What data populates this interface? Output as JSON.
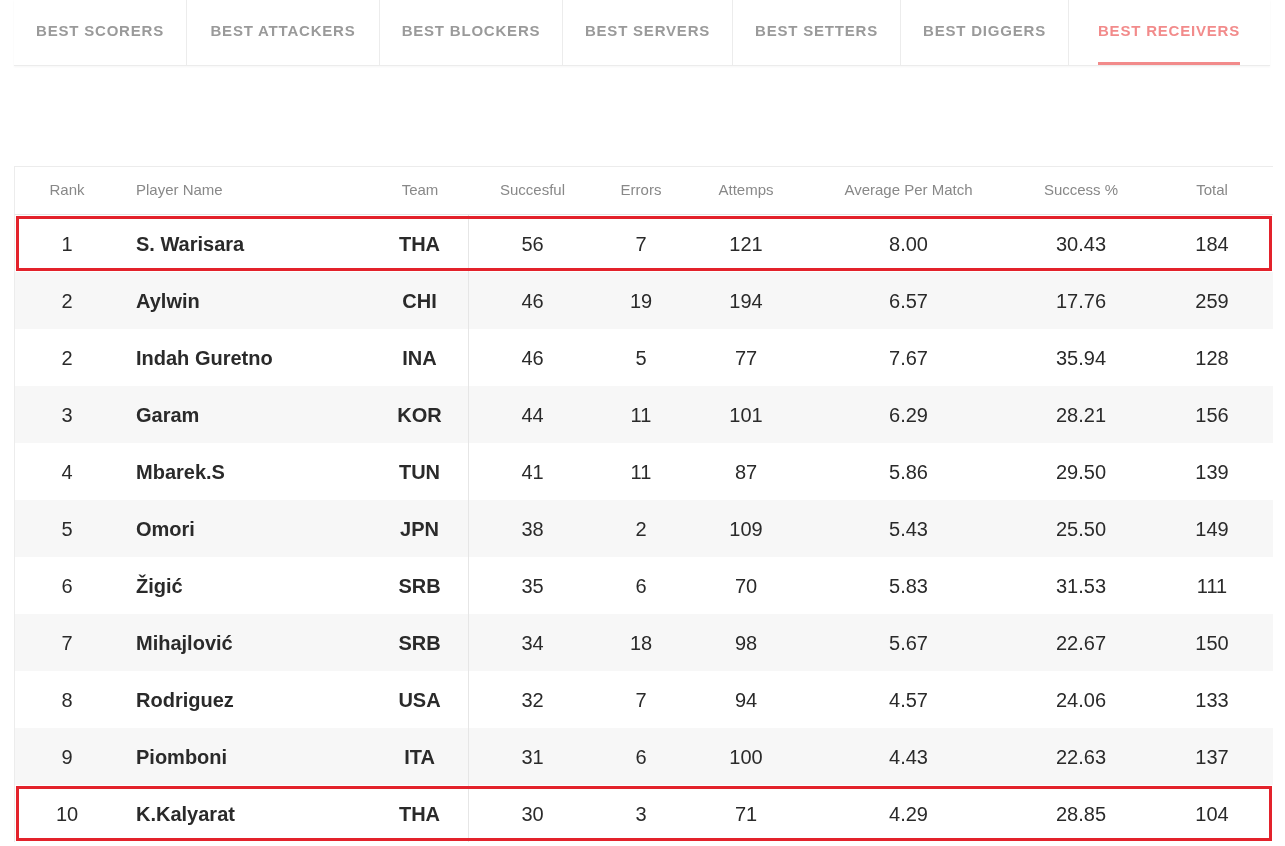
{
  "tabs": [
    {
      "label": "BEST SCORERS",
      "selected": false
    },
    {
      "label": "BEST ATTACKERS",
      "selected": false
    },
    {
      "label": "BEST BLOCKERS",
      "selected": false
    },
    {
      "label": "BEST SERVERS",
      "selected": false
    },
    {
      "label": "BEST SETTERS",
      "selected": false
    },
    {
      "label": "BEST DIGGERS",
      "selected": false
    },
    {
      "label": "BEST RECEIVERS",
      "selected": true
    }
  ],
  "table": {
    "columns": [
      "Rank",
      "Player Name",
      "Team",
      "Succesful",
      "Errors",
      "Attemps",
      "Average Per Match",
      "Success %",
      "Total"
    ],
    "rows": [
      {
        "cells": [
          "1",
          "S. Warisara",
          "THA",
          "56",
          "7",
          "121",
          "8.00",
          "30.43",
          "184"
        ],
        "highlighted": true
      },
      {
        "cells": [
          "2",
          "Aylwin",
          "CHI",
          "46",
          "19",
          "194",
          "6.57",
          "17.76",
          "259"
        ],
        "highlighted": false
      },
      {
        "cells": [
          "2",
          "Indah Guretno",
          "INA",
          "46",
          "5",
          "77",
          "7.67",
          "35.94",
          "128"
        ],
        "highlighted": false
      },
      {
        "cells": [
          "3",
          "Garam",
          "KOR",
          "44",
          "11",
          "101",
          "6.29",
          "28.21",
          "156"
        ],
        "highlighted": false
      },
      {
        "cells": [
          "4",
          "Mbarek.S",
          "TUN",
          "41",
          "11",
          "87",
          "5.86",
          "29.50",
          "139"
        ],
        "highlighted": false
      },
      {
        "cells": [
          "5",
          "Omori",
          "JPN",
          "38",
          "2",
          "109",
          "5.43",
          "25.50",
          "149"
        ],
        "highlighted": false
      },
      {
        "cells": [
          "6",
          "Žigić",
          "SRB",
          "35",
          "6",
          "70",
          "5.83",
          "31.53",
          "111"
        ],
        "highlighted": false
      },
      {
        "cells": [
          "7",
          "Mihajlović",
          "SRB",
          "34",
          "18",
          "98",
          "5.67",
          "22.67",
          "150"
        ],
        "highlighted": false
      },
      {
        "cells": [
          "8",
          "Rodriguez",
          "USA",
          "32",
          "7",
          "94",
          "4.57",
          "24.06",
          "133"
        ],
        "highlighted": false
      },
      {
        "cells": [
          "9",
          "Piomboni",
          "ITA",
          "31",
          "6",
          "100",
          "4.43",
          "22.63",
          "137"
        ],
        "highlighted": false
      },
      {
        "cells": [
          "10",
          "K.Kalyarat",
          "THA",
          "30",
          "3",
          "71",
          "4.29",
          "28.85",
          "104"
        ],
        "highlighted": true
      }
    ]
  }
}
